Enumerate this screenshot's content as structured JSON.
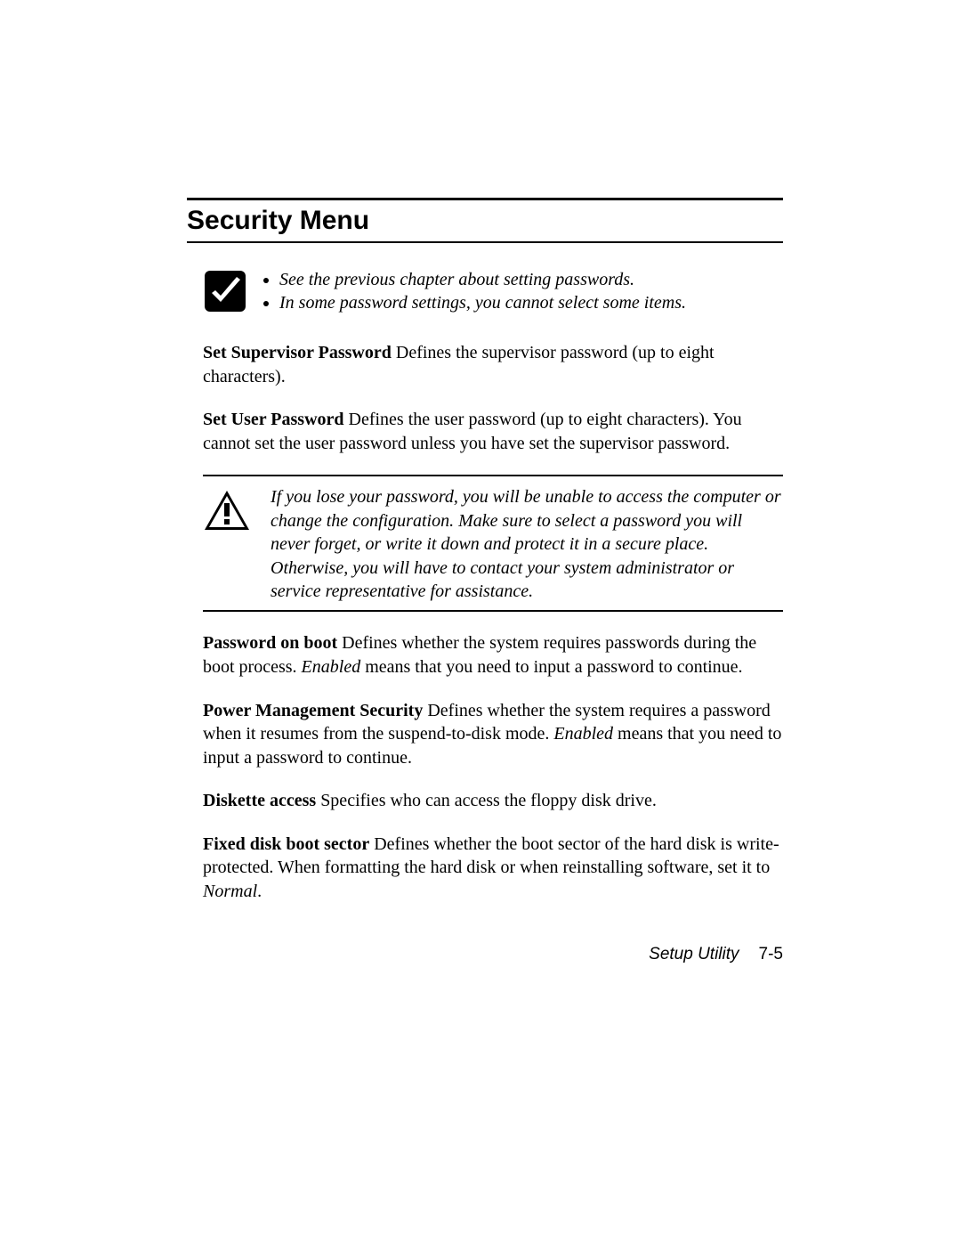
{
  "heading": "Security Menu",
  "note": {
    "items": [
      "See the previous chapter about setting passwords.",
      "In some password settings, you cannot select some items."
    ]
  },
  "para1": {
    "bold": "Set Supervisor Password",
    "rest": " Defines the supervisor password (up to eight characters)."
  },
  "para2": {
    "bold": "Set User Password",
    "rest": " Defines the user password (up to eight characters). You cannot set the user password unless you have set the supervisor password."
  },
  "warning": {
    "text": "If you lose your password, you will be unable to access the computer or change the configuration. Make sure to select a password you will never forget, or write it down and protect it in a secure place.  Otherwise, you will have to contact your system administrator or service representative for assistance."
  },
  "para3": {
    "bold": "Password on boot",
    "seg1": " Defines whether the system requires passwords during the boot process. ",
    "ital": "Enabled",
    "seg2": " means that you need to input a password to continue."
  },
  "para4": {
    "bold": "Power Management Security",
    "seg1": " Defines whether the system requires a password when it resumes from the suspend-to-disk mode. ",
    "ital": "Enabled",
    "seg2": " means that you need to input a password to continue."
  },
  "para5": {
    "bold": "Diskette access",
    "rest": " Specifies who can access the floppy disk drive."
  },
  "para6": {
    "bold": "Fixed disk boot sector",
    "seg1": " Defines whether the boot sector of the hard disk is write-protected. When formatting the hard disk or when reinstalling software, set it to ",
    "ital": "Normal",
    "seg2": "."
  },
  "footer": {
    "label": "Setup Utility",
    "page": "7-5"
  }
}
